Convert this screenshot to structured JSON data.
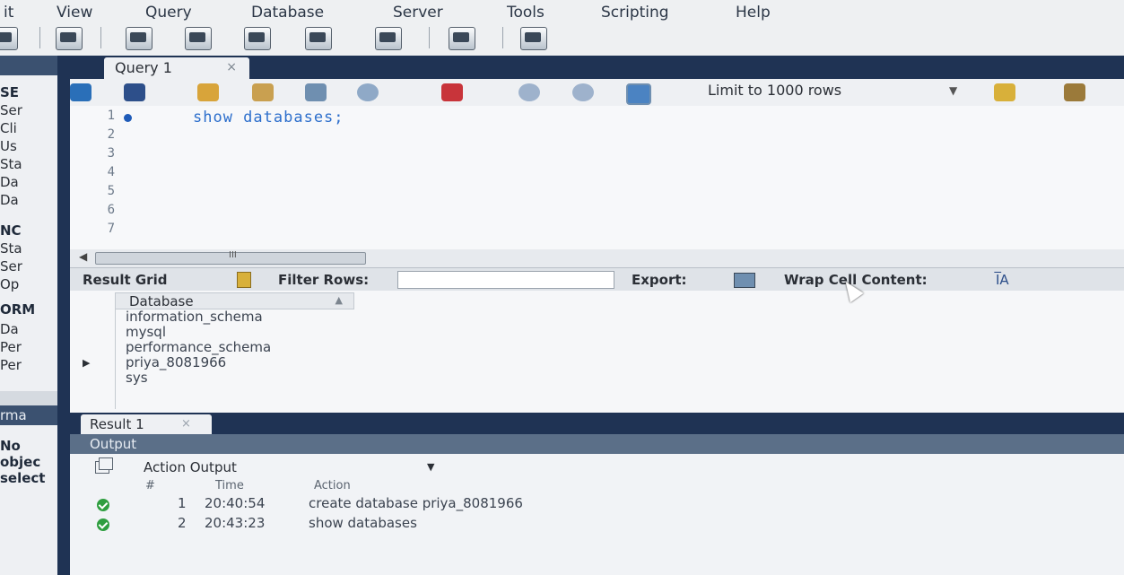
{
  "menu": {
    "items": [
      "it",
      "View",
      "Query",
      "Database",
      "Server",
      "Tools",
      "Scripting",
      "Help"
    ]
  },
  "toolbar": {
    "buttons": [
      "new-connection-icon",
      "open-sql-icon",
      "new-schema-icon",
      "new-table-icon",
      "new-view-icon",
      "new-procedure-icon",
      "new-function-icon",
      "search-table-icon",
      "reconnect-icon"
    ]
  },
  "sidebar": {
    "items": [
      "SE",
      "Ser",
      "Cli",
      "Us",
      "Sta",
      "Da",
      "Da",
      "NC",
      "Sta",
      "Ser",
      "Op",
      "ORM",
      "Da",
      "Per",
      "Per",
      "rma",
      "No",
      "objec",
      "select"
    ]
  },
  "query_tab": {
    "label": "Query 1",
    "close": "×"
  },
  "editor_toolbar": {
    "icons": [
      "open-file-icon",
      "save-icon",
      "execute-icon",
      "execute-current-icon",
      "explain-icon",
      "stop-icon",
      "toggle-error-icon",
      "commit-icon",
      "rollback-icon",
      "autocommit-icon"
    ],
    "limit": "Limit to 1000 rows",
    "extra_icons": [
      "beautify-icon",
      "find-icon"
    ]
  },
  "editor": {
    "lines": [
      "1",
      "2",
      "3",
      "4",
      "5",
      "6",
      "7"
    ],
    "sql": "show databases;"
  },
  "hscroll": {
    "thumb_label": "III"
  },
  "result_toolbar": {
    "result_grid": "Result Grid",
    "filter_rows": "Filter Rows:",
    "export": "Export:",
    "wrap": "Wrap Cell Content:",
    "wrap_icon_text": "I̅A"
  },
  "grid": {
    "header": "Database",
    "rows": [
      "information_schema",
      "mysql",
      "performance_schema",
      "priya_8081966",
      "sys"
    ]
  },
  "result_tab": {
    "label": "Result 1",
    "close": "×"
  },
  "output": {
    "header": "Output",
    "selector": "Action Output",
    "columns": {
      "num": "#",
      "time": "Time",
      "action": "Action"
    },
    "rows": [
      {
        "num": "1",
        "time": "20:40:54",
        "action": "create database priya_8081966"
      },
      {
        "num": "2",
        "time": "20:43:23",
        "action": "show databases"
      }
    ]
  },
  "colors": {
    "frame": "#1f3354",
    "sql": "#2d6fcc",
    "ok": "#2f9e40"
  }
}
